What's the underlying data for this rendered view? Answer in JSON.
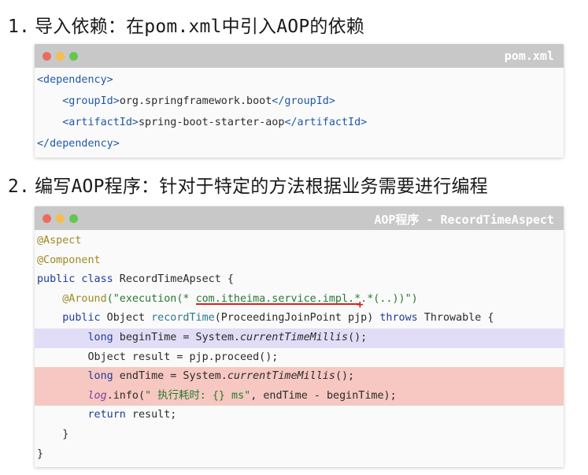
{
  "step1": {
    "number": "1.",
    "title": "导入依赖：在pom.xml中引入AOP的依赖"
  },
  "pom_window": {
    "title": "pom.xml",
    "lines": {
      "l1": {
        "tag": "<dependency>"
      },
      "l2": {
        "open": "<groupId>",
        "text": "org.springframework.boot",
        "close": "</groupId>"
      },
      "l3": {
        "open": "<artifactId>",
        "text": "spring-boot-starter-aop",
        "close": "</artifactId>"
      },
      "l4": {
        "tag": "</dependency>"
      }
    }
  },
  "step2": {
    "number": "2.",
    "title": "编写AOP程序：针对于特定的方法根据业务需要进行编程"
  },
  "aop_window": {
    "title": "AOP程序 - RecordTimeAspect",
    "code": {
      "l1": "@Aspect",
      "l2": "@Component",
      "l3_kw": "public class",
      "l3_rest": " RecordTimeApsect {",
      "l4_ann": "@Around",
      "l4_p1": "(\"execution(* ",
      "l4_pkg": "com.itheima.service.impl.*",
      "l4_p2": ".*(..))\")",
      "l5_kw1": "public",
      "l5_t1": " Object ",
      "l5_fn": "recordTime",
      "l5_t2": "(ProceedingJoinPoint pjp) ",
      "l5_kw2": "throws",
      "l5_t3": " Throwable {",
      "l6_kw": "long",
      "l6_t1": " beginTime = System.",
      "l6_it": "currentTimeMillis",
      "l6_t2": "();",
      "l7": "Object result = pjp.proceed();",
      "l8_kw": "long",
      "l8_t1": " endTime = System.",
      "l8_it": "currentTimeMillis",
      "l8_t2": "();",
      "l9_log": "log",
      "l9_t1": ".info(",
      "l9_str": "\" 执行耗时: {} ms\"",
      "l9_t2": ", endTime - beginTime);",
      "l10_kw": "return",
      "l10_t": " result;",
      "l11": "}",
      "l12": "}"
    },
    "plus_marker": "+"
  },
  "colors": {
    "highlight_purple": "#e1ddf7",
    "highlight_red": "#f6c8c1",
    "underline_red": "#d8201e"
  }
}
